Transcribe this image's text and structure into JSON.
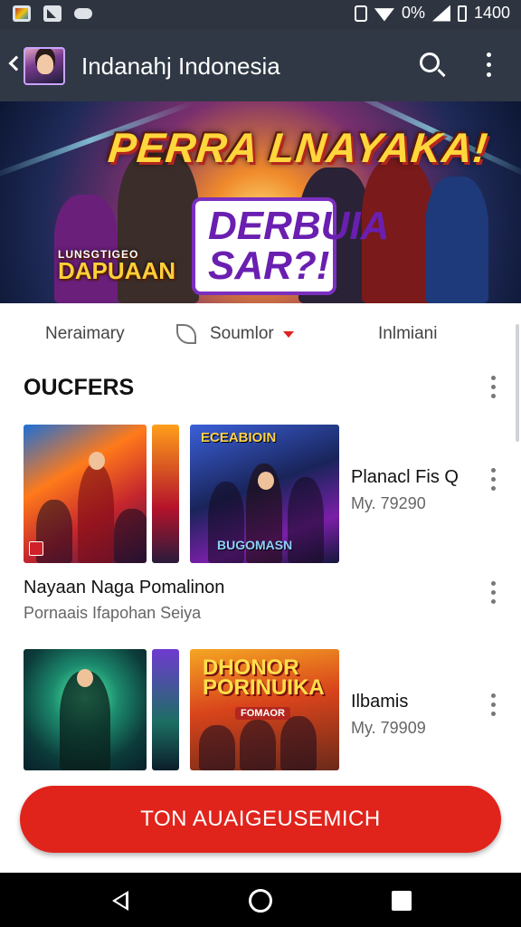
{
  "status_bar": {
    "battery_percent": "0%",
    "time": "1400",
    "icons": [
      "photo-icon",
      "image-icon",
      "pill-icon",
      "vibrate-icon",
      "wifi-icon",
      "signal-icon",
      "battery-icon"
    ]
  },
  "app_bar": {
    "title": "Indanahj Indonesia",
    "icons": [
      "back-arrow-icon",
      "avatar",
      "search-icon",
      "more-vert-icon"
    ]
  },
  "banner": {
    "title": "PERRA LNAYAKA!",
    "center_text": "DERBUIA SAR?!",
    "left_small": "LUNSGTIGEO",
    "left_text": "DAPUAAN"
  },
  "tabs": {
    "items": [
      "Neraimary",
      "Soumlor",
      "Inlmiani"
    ],
    "selected": "Soumlor"
  },
  "section": {
    "title": "OUCFERS"
  },
  "items": [
    {
      "side_title": "Planacl Fis Q",
      "side_price": "My. 79290",
      "thumb_label": "ECEABIOIN",
      "thumb_bottom": "BUGOMASN",
      "title": "Nayaan Naga Pomalinon",
      "subtitle": "Pornaais Ifapohan Seiya"
    },
    {
      "side_title": "Ilbamis",
      "side_price": "My. 79909",
      "thumb_label": "DHONOR PORINUIKA",
      "thumb_sub": "FOMAOR"
    }
  ],
  "cta": {
    "label": "TON AUAIGEUSEMICH"
  },
  "colors": {
    "status_bar": "#2e3540",
    "app_bar": "#2f3844",
    "accent_red": "#e0241c",
    "nav_bar": "#000000"
  },
  "nav_bar": {
    "icons": [
      "nav-back-icon",
      "nav-home-icon",
      "nav-recents-icon"
    ]
  }
}
